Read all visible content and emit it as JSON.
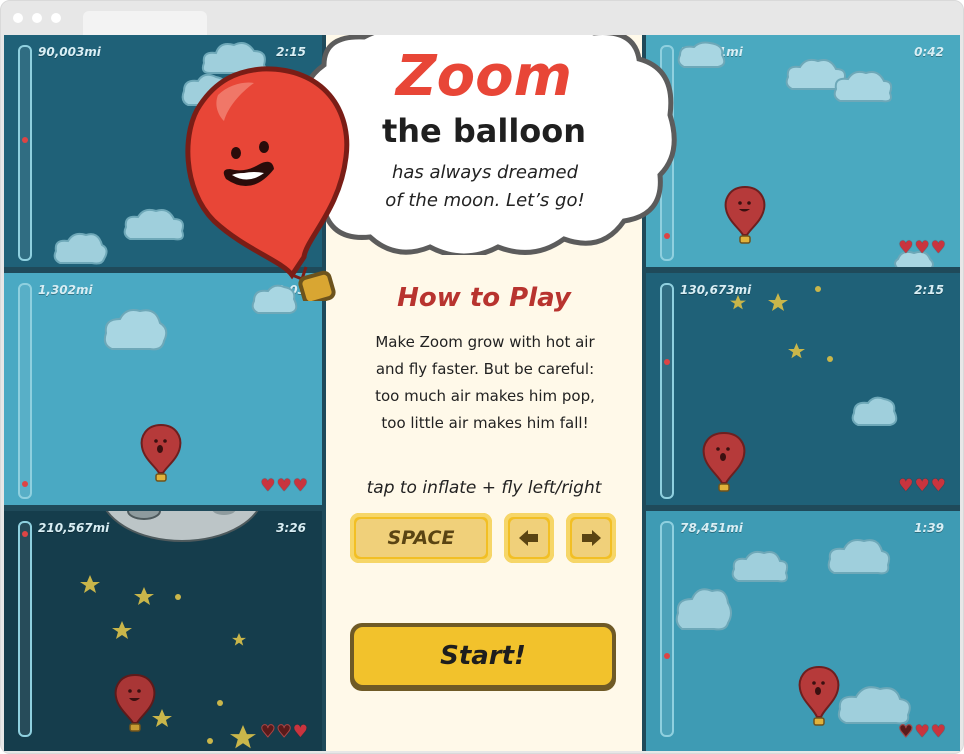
{
  "browser": {
    "tab_title": ""
  },
  "panels": [
    {
      "id": "top-left",
      "distance": "90,003mi",
      "time": "2:15",
      "hearts": 3
    },
    {
      "id": "middle-left",
      "distance": "1,302mi",
      "time": "0:03",
      "hearts": 3
    },
    {
      "id": "bottom-left",
      "distance": "210,567mi",
      "time": "3:26",
      "hearts": 3
    },
    {
      "id": "top-right",
      "distance": "14,601mi",
      "time": "0:42",
      "hearts": 3
    },
    {
      "id": "middle-right",
      "distance": "130,673mi",
      "time": "2:15",
      "hearts": 3
    },
    {
      "id": "bottom-right",
      "distance": "78,451mi",
      "time": "1:39",
      "hearts": 3
    }
  ],
  "intro": {
    "title": "Zoom",
    "subtitle": "the balloon",
    "tagline_line1": "has always dreamed",
    "tagline_line2": "of the moon. Let’s go!"
  },
  "how_to_play": {
    "heading": "How to Play",
    "lines": [
      "Make Zoom grow with hot air",
      "and fly faster. But be careful:",
      "too much air makes him pop,",
      "too little air makes him fall!"
    ],
    "controls_caption": "tap to inflate + fly left/right",
    "space_key": "SPACE",
    "left_key_icon": "arrow-left-icon",
    "right_key_icon": "arrow-right-icon"
  },
  "start_button": "Start!",
  "colors": {
    "zoom_red": "#e84637",
    "how_to_heading": "#b8342f",
    "button_yellow": "#f2c22c",
    "panel_dark": "#1f4a5a",
    "panel_light": "#4aa9c0",
    "heart": "#c9343e"
  }
}
